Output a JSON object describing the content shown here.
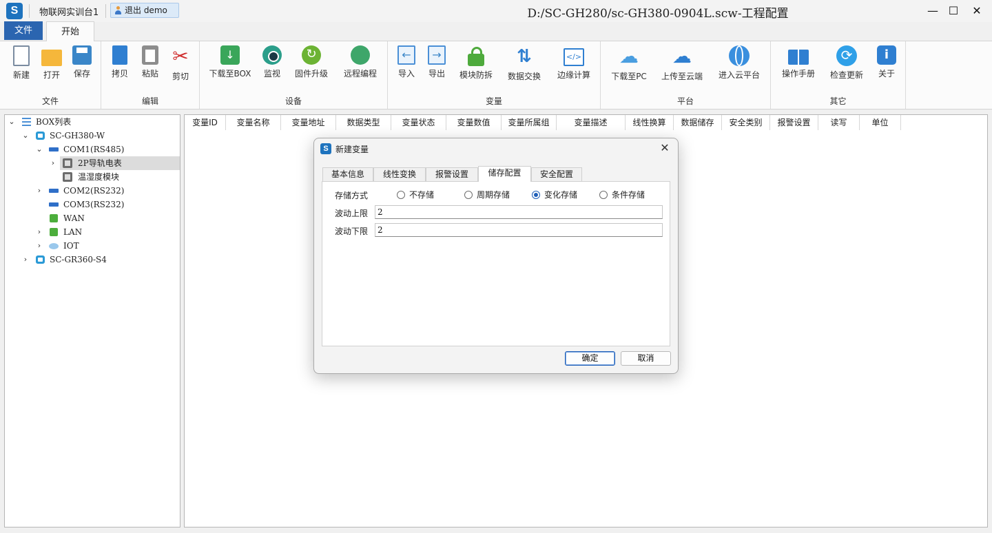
{
  "titlebar": {
    "app_name": "物联网实训台1",
    "user_chip": "退出 demo",
    "doc_title": "D:/SC-GH280/sc-GH380-0904L.scw-工程配置",
    "minimize": "—",
    "maximize": "☐",
    "close": "✕"
  },
  "ribbon": {
    "tabs": {
      "file": "文件",
      "start": "开始"
    },
    "groups": {
      "file": {
        "label": "文件",
        "new": "新建",
        "open": "打开",
        "save": "保存"
      },
      "edit": {
        "label": "编辑",
        "copy": "拷贝",
        "paste": "粘贴",
        "cut": "剪切"
      },
      "device": {
        "label": "设备",
        "download_box": "下载至BOX",
        "monitor": "监视",
        "firmware": "固件升级",
        "remote": "远程编程"
      },
      "variable": {
        "label": "变量",
        "import": "导入",
        "export": "导出",
        "module_protect": "模块防拆",
        "data_exchange": "数据交换",
        "edge_compute": "边缘计算"
      },
      "platform": {
        "label": "平台",
        "download_pc": "下载至PC",
        "upload_cloud": "上传至云端",
        "enter_cloud": "进入云平台"
      },
      "other": {
        "label": "其它",
        "manual": "操作手册",
        "check_update": "检查更新",
        "about": "关于"
      }
    }
  },
  "tree": {
    "root": "BOX列表",
    "device1": "SC-GH380-W",
    "com1": "COM1(RS485)",
    "meter": "2P导轨电表",
    "humidity": "温湿度模块",
    "com2": "COM2(RS232)",
    "com3": "COM3(RS232)",
    "wan": "WAN",
    "lan": "LAN",
    "iot": "IOT",
    "device2": "SC-GR360-S4"
  },
  "grid": {
    "columns": [
      "变量ID",
      "变量名称",
      "变量地址",
      "数据类型",
      "变量状态",
      "变量数值",
      "变量所属组",
      "变量描述",
      "线性换算",
      "数据储存",
      "安全类别",
      "报警设置",
      "读写",
      "单位"
    ]
  },
  "dialog": {
    "title": "新建变量",
    "close": "✕",
    "tabs": [
      "基本信息",
      "线性变换",
      "报警设置",
      "储存配置",
      "安全配置"
    ],
    "active_tab": "储存配置",
    "storage_mode_label": "存储方式",
    "storage_options": [
      "不存储",
      "周期存储",
      "变化存储",
      "条件存储"
    ],
    "storage_selected": "变化存储",
    "upper_label": "波动上限",
    "upper_value": "2",
    "lower_label": "波动下限",
    "lower_value": "2",
    "ok": "确定",
    "cancel": "取消"
  },
  "colors": {
    "accent": "#2b65b0",
    "radio_checked": "#1f5fb8"
  }
}
